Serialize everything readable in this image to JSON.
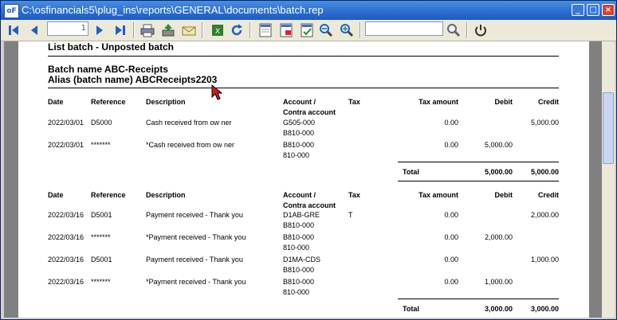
{
  "window": {
    "title": "C:\\osfinancials5\\plug_ins\\reports\\GENERAL\\documents\\batch.rep",
    "icon_label": "oF",
    "controls": [
      "_",
      "□",
      "×"
    ]
  },
  "toolbar": {
    "page_number": "1",
    "search_value": "",
    "icons": [
      "first-page-icon",
      "prev-page-icon",
      "next-page-icon",
      "last-page-icon",
      "print-icon",
      "save-icon",
      "email-icon",
      "export-excel-icon",
      "refresh-icon",
      "page-setup-icon",
      "page-setup-2-icon",
      "page-setup-3-icon",
      "zoom-out-icon",
      "zoom-in-icon",
      "search-icon",
      "close-preview-icon"
    ]
  },
  "report": {
    "title": "List batch -  Unposted batch",
    "batch_name": "Batch name  ABC-Receipts",
    "alias": "Alias (batch name)  ABCReceipts2203",
    "headers": {
      "date": "Date",
      "reference": "Reference",
      "description": "Description",
      "account": "Account /",
      "contra": "Contra account",
      "tax": "Tax",
      "tax_amount": "Tax amount",
      "debit": "Debit",
      "credit": "Credit"
    },
    "groups": [
      {
        "rows": [
          {
            "date": "2022/03/01",
            "reference": "D5000",
            "description": "Cash received from ow ner",
            "account": "G505-000",
            "contra": "B810-000",
            "tax": "",
            "tax_amount": "0.00",
            "debit": "",
            "credit": "5,000.00"
          },
          {
            "date": "2022/03/01",
            "reference": "*******",
            "description": "*Cash received from ow ner",
            "account": "B810-000",
            "contra": "810-000",
            "tax": "",
            "tax_amount": "0.00",
            "debit": "5,000.00",
            "credit": ""
          }
        ],
        "total_label": "Total",
        "total_debit": "5,000.00",
        "total_credit": "5,000.00"
      },
      {
        "rows": [
          {
            "date": "2022/03/16",
            "reference": "D5001",
            "description": "Payment received - Thank you",
            "account": "D1AB-GRE",
            "contra": "B810-000",
            "tax": "T",
            "tax_amount": "0.00",
            "debit": "",
            "credit": "2,000.00"
          },
          {
            "date": "2022/03/16",
            "reference": "*******",
            "description": "*Payment received - Thank you",
            "account": "B810-000",
            "contra": "810-000",
            "tax": "",
            "tax_amount": "0.00",
            "debit": "2,000.00",
            "credit": ""
          },
          {
            "date": "2022/03/16",
            "reference": "D5001",
            "description": "Payment received - Thank you",
            "account": "D1MA-CDS",
            "contra": "B810-000",
            "tax": "",
            "tax_amount": "0.00",
            "debit": "",
            "credit": "1,000.00"
          },
          {
            "date": "2022/03/16",
            "reference": "*******",
            "description": "*Payment received - Thank you",
            "account": "B810-000",
            "contra": "810-000",
            "tax": "",
            "tax_amount": "0.00",
            "debit": "1,000.00",
            "credit": ""
          }
        ],
        "total_label": "Total",
        "total_debit": "3,000.00",
        "total_credit": "3,000.00"
      }
    ]
  }
}
